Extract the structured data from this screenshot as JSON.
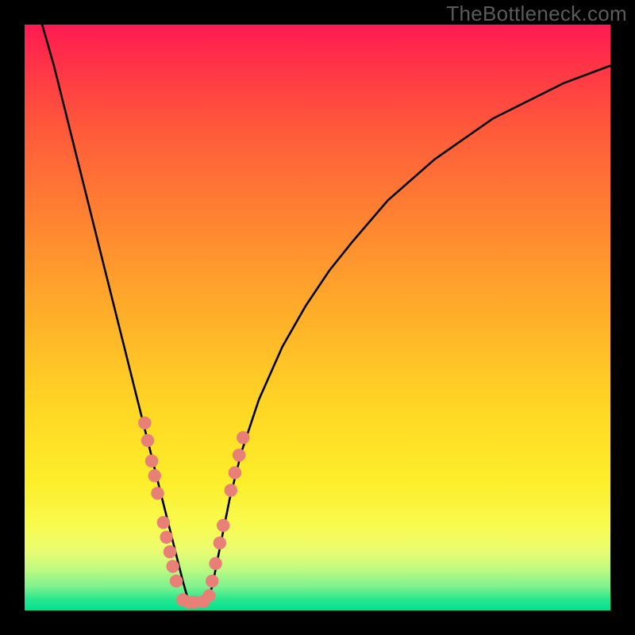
{
  "watermark": "TheBottleneck.com",
  "colors": {
    "frame": "#000000",
    "gradient_top": "#ff1a53",
    "gradient_bottom": "#00e28f",
    "curve_stroke": "#000000",
    "marker_fill": "#e98077",
    "marker_stroke": "#c95a50"
  },
  "chart_data": {
    "type": "line",
    "title": "",
    "xlabel": "",
    "ylabel": "",
    "xlim": [
      0,
      100
    ],
    "ylim": [
      0,
      100
    ],
    "grid": false,
    "legend": false,
    "curve_minimum_x": 28,
    "series": [
      {
        "name": "bottleneck-curve",
        "description": "V-shaped curve; x values in 0-100 of plot width, y values are height (0 = bottom, 100 = top). Curve bottoms out near x≈28.",
        "x": [
          3,
          5,
          7,
          9,
          11,
          13,
          15,
          17,
          19,
          20,
          21,
          22,
          23,
          24,
          25,
          26,
          27,
          28,
          29,
          30,
          31,
          32,
          33,
          34,
          35,
          37,
          40,
          44,
          48,
          52,
          56,
          62,
          70,
          80,
          92,
          100
        ],
        "y": [
          100,
          93,
          85,
          77,
          69,
          61,
          53,
          45,
          37,
          33,
          29,
          25,
          21,
          17,
          13,
          9,
          5,
          1.5,
          1.4,
          1.4,
          1.5,
          4,
          9,
          14,
          19,
          27,
          36,
          45,
          52,
          58,
          63,
          70,
          77,
          84,
          90,
          93
        ]
      },
      {
        "name": "markers",
        "description": "Salmon circular markers clustered near the bottom of the V and along the lower limbs.",
        "points": [
          {
            "x": 20.5,
            "y": 32
          },
          {
            "x": 21.0,
            "y": 29
          },
          {
            "x": 21.7,
            "y": 25.5
          },
          {
            "x": 22.2,
            "y": 23
          },
          {
            "x": 22.7,
            "y": 20
          },
          {
            "x": 23.7,
            "y": 15
          },
          {
            "x": 24.2,
            "y": 12.5
          },
          {
            "x": 24.8,
            "y": 10
          },
          {
            "x": 25.3,
            "y": 7.5
          },
          {
            "x": 25.9,
            "y": 5
          },
          {
            "x": 27.0,
            "y": 1.8
          },
          {
            "x": 28.0,
            "y": 1.4
          },
          {
            "x": 29.0,
            "y": 1.4
          },
          {
            "x": 30.5,
            "y": 1.5
          },
          {
            "x": 31.5,
            "y": 2.5
          },
          {
            "x": 32.0,
            "y": 5
          },
          {
            "x": 32.6,
            "y": 8
          },
          {
            "x": 33.3,
            "y": 11.5
          },
          {
            "x": 33.9,
            "y": 14.5
          },
          {
            "x": 35.2,
            "y": 20.5
          },
          {
            "x": 35.9,
            "y": 23.5
          },
          {
            "x": 36.6,
            "y": 26.5
          },
          {
            "x": 37.3,
            "y": 29.5
          }
        ]
      }
    ]
  }
}
